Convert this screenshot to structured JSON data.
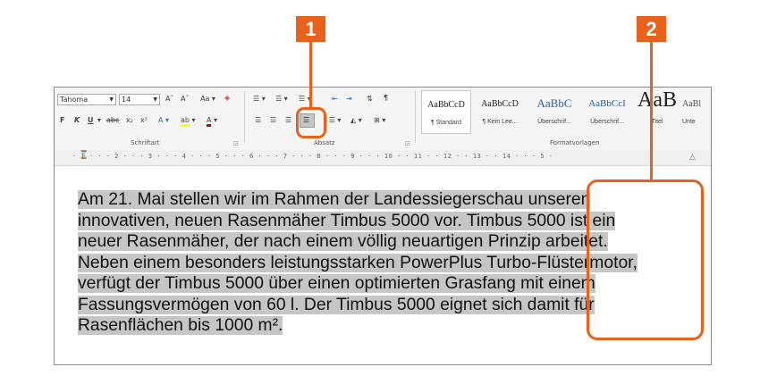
{
  "callouts": {
    "one": "1",
    "two": "2"
  },
  "colors": {
    "accent": "#e9621c",
    "selection": "#c6c6c6"
  },
  "ribbon": {
    "font_name": "Tahoma",
    "font_size": "14",
    "grow_font": "Aˆ",
    "shrink_font": "Aˇ",
    "change_case": "Aa",
    "bold": "F",
    "italic": "K",
    "underline": "U",
    "strikethrough": "abc",
    "subscript": "x₂",
    "superscript": "x²",
    "highlight_letter": "ab",
    "font_color_letter": "A",
    "text_effect_letter": "A",
    "group_font": "Schriftart",
    "group_paragraph": "Absatz",
    "group_styles": "Formatvorlagen",
    "styles": [
      {
        "preview": "AaBbCcD",
        "name": "¶ Standard"
      },
      {
        "preview": "AaBbCcD",
        "name": "¶ Kein Lee..."
      },
      {
        "preview": "AaBbC",
        "name": "Überschrif..."
      },
      {
        "preview": "AaBbCcI",
        "name": "Überschrif..."
      },
      {
        "preview": "AaB",
        "name": "Titel"
      },
      {
        "preview": "AaBl",
        "name": "Unte"
      }
    ]
  },
  "ruler": {
    "text": "· 1 · · · 2 · · · 3 · · · 4 · · · 5 · · · 6 · · · 7 · · · 8 · · · 9 · · · 10 · · 11 · · 12 · · 13 · · 14 · · · 5 ·"
  },
  "document": {
    "lines": [
      "Am 21. Mai stellen wir im Rahmen der Landessiegerschau unseren",
      "innovativen, neuen Rasenmäher Timbus 5000 vor. Timbus 5000 ist ein",
      "neuer Rasenmäher, der nach einem völlig neuartigen Prinzip arbeitet.",
      "Neben einem besonders leistungsstarken PowerPlus Turbo-Flüstermotor,",
      "verfügt der Timbus 5000 über einen optimierten Grasfang mit einem",
      "Fassungsvermögen von 60 l. Der Timbus 5000 eignet sich damit für",
      "Rasenflächen bis 1000 m²."
    ]
  }
}
